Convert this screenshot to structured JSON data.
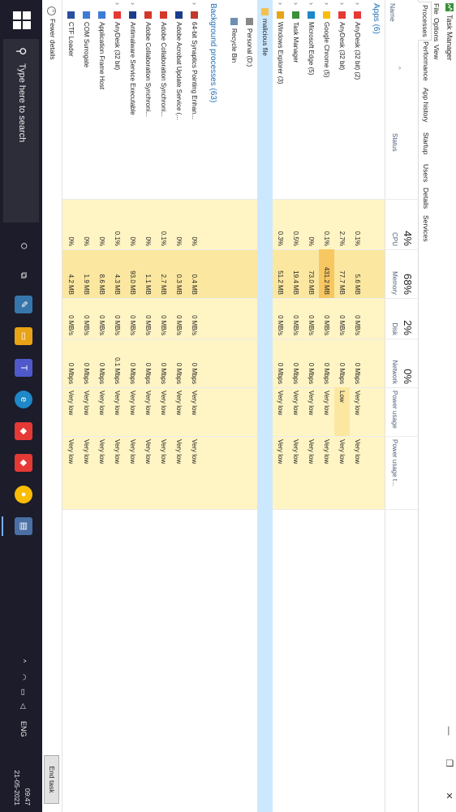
{
  "window": {
    "title": "Task Manager",
    "minimize": "—",
    "maximize": "❐",
    "close": "✕"
  },
  "menu": [
    "File",
    "Options",
    "View"
  ],
  "tabs": [
    "Processes",
    "Performance",
    "App history",
    "Startup",
    "Users",
    "Details",
    "Services"
  ],
  "header": {
    "name": "Name",
    "status": "Status",
    "cpu": {
      "pct": "4%",
      "label": "CPU"
    },
    "memory": {
      "pct": "68%",
      "label": "Memory"
    },
    "disk": {
      "pct": "2%",
      "label": "Disk"
    },
    "network": {
      "pct": "0%",
      "label": "Network"
    },
    "power": "Power usage",
    "power_trend": "Power usage t..."
  },
  "groups": {
    "apps": "Apps (6)",
    "background": "Background processes (63)"
  },
  "apps": [
    {
      "name": "AnyDesk (32 bit) (2)",
      "icon": "anydesk-icon",
      "cpu": "0.1%",
      "memory": "5.6 MB",
      "disk": "0 MB/s",
      "network": "0 Mbps",
      "power": "Very low",
      "trend": "Very low"
    },
    {
      "name": "AnyDesk (32 bit)",
      "icon": "anydesk-icon",
      "cpu": "2.7%",
      "memory": "77.7 MB",
      "disk": "0 MB/s",
      "network": "0 Mbps",
      "power": "Low",
      "trend": "Very low"
    },
    {
      "name": "Google Chrome (5)",
      "icon": "chrome-icon",
      "cpu": "0.1%",
      "memory": "431.2 MB",
      "disk": "0 MB/s",
      "network": "0 Mbps",
      "power": "Very low",
      "trend": "Very low"
    },
    {
      "name": "Microsoft Edge (5)",
      "icon": "edge-icon",
      "cpu": "0%",
      "memory": "73.0 MB",
      "disk": "0 MB/s",
      "network": "0 Mbps",
      "power": "Very low",
      "trend": "Very low"
    },
    {
      "name": "Task Manager",
      "icon": "task-manager-icon",
      "cpu": "0.5%",
      "memory": "19.4 MB",
      "disk": "0 MB/s",
      "network": "0 Mbps",
      "power": "Very low",
      "trend": "Very low"
    },
    {
      "name": "Windows Explorer (3)",
      "icon": "explorer-icon",
      "cpu": "0.3%",
      "memory": "51.2 MB",
      "disk": "0 MB/s",
      "network": "0 Mbps",
      "power": "Very low",
      "trend": "Very low"
    }
  ],
  "explorer_children": [
    {
      "name": "malicious file",
      "icon": "folder-icon"
    },
    {
      "name": "Personal (D:)",
      "icon": "drive-icon"
    },
    {
      "name": "Recycle Bin",
      "icon": "recycle-bin-icon"
    }
  ],
  "background": [
    {
      "name": "64-bit Synaptics Pointing Enhan...",
      "icon": "synaptics-icon",
      "cpu": "0%",
      "memory": "0.4 MB",
      "disk": "0 MB/s",
      "network": "0 Mbps",
      "power": "Very low",
      "trend": "Very low"
    },
    {
      "name": "Adobe Acrobat Update Service (...",
      "icon": "service-icon",
      "cpu": "0%",
      "memory": "0.3 MB",
      "disk": "0 MB/s",
      "network": "0 Mbps",
      "power": "Very low",
      "trend": "Very low"
    },
    {
      "name": "Adobe Collaboration Synchroni...",
      "icon": "adobe-icon",
      "cpu": "0.1%",
      "memory": "2.7 MB",
      "disk": "0 MB/s",
      "network": "0 Mbps",
      "power": "Very low",
      "trend": "Very low"
    },
    {
      "name": "Adobe Collaboration Synchroni...",
      "icon": "adobe-icon",
      "cpu": "0%",
      "memory": "1.1 MB",
      "disk": "0 MB/s",
      "network": "0 Mbps",
      "power": "Very low",
      "trend": "Very low"
    },
    {
      "name": "Antimalware Service Executable",
      "icon": "service-icon",
      "cpu": "0%",
      "memory": "93.0 MB",
      "disk": "0 MB/s",
      "network": "0 Mbps",
      "power": "Very low",
      "trend": "Very low"
    },
    {
      "name": "AnyDesk (32 bit)",
      "icon": "anydesk-icon",
      "cpu": "0.1%",
      "memory": "4.3 MB",
      "disk": "0 MB/s",
      "network": "0.1 Mbps",
      "power": "Very low",
      "trend": "Very low"
    },
    {
      "name": "Application Frame Host",
      "icon": "app-frame-icon",
      "cpu": "0%",
      "memory": "8.6 MB",
      "disk": "0 MB/s",
      "network": "0 Mbps",
      "power": "Very low",
      "trend": "Very low"
    },
    {
      "name": "COM Surrogate",
      "icon": "com-surrogate-icon",
      "cpu": "0%",
      "memory": "1.9 MB",
      "disk": "0 MB/s",
      "network": "0 Mbps",
      "power": "Very low",
      "trend": "Very low"
    },
    {
      "name": "CTF Loader",
      "icon": "ctf-loader-icon",
      "cpu": "0%",
      "memory": "4.2 MB",
      "disk": "0 MB/s",
      "network": "0 Mbps",
      "power": "Very low",
      "trend": "Very low"
    }
  ],
  "footer": {
    "fewer_details": "Fewer details",
    "end_task": "End task"
  },
  "taskbar": {
    "search_placeholder": "Type here to search",
    "tray": {
      "chevron": "^",
      "language": "ENG",
      "time": "09:47",
      "date": "21-05-2021"
    }
  },
  "colors": {
    "heat_light": "#fff4c4",
    "heat_mid": "#fbe7a0",
    "heat_high": "#f7c862",
    "selection": "#cce8ff",
    "group_title": "#1f6fb5"
  }
}
